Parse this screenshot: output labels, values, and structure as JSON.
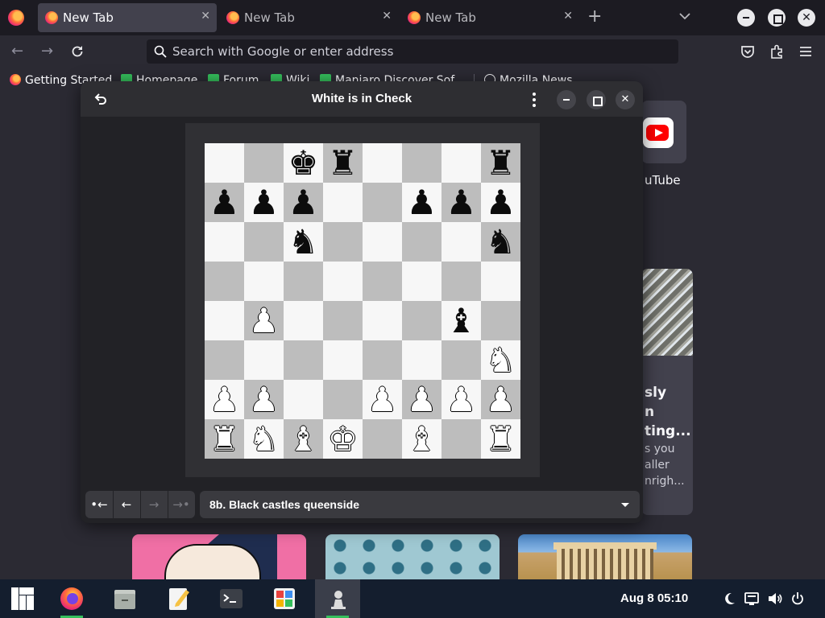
{
  "browser": {
    "tabs": [
      {
        "title": "New Tab",
        "active": true
      },
      {
        "title": "New Tab",
        "active": false
      },
      {
        "title": "New Tab",
        "active": false
      }
    ],
    "tab_close_glyph": "✕",
    "new_tab_glyph": "+",
    "urlbar": {
      "placeholder": "Search with Google or enter address",
      "value": ""
    },
    "bookmarks": [
      {
        "label": "Getting Started",
        "icon": "firefox-icon"
      },
      {
        "label": "Homepage",
        "icon": "manjaro-icon"
      },
      {
        "label": "Forum",
        "icon": "manjaro-icon"
      },
      {
        "label": "Wiki",
        "icon": "manjaro-icon"
      },
      {
        "label": "Manjaro Discover Sof...",
        "icon": "manjaro-icon"
      },
      {
        "label": "Mozilla News",
        "icon": "globe-icon"
      }
    ],
    "shortcut": {
      "label": "uTube",
      "icon": "youtube-icon"
    },
    "story": {
      "title": "sly\nn\nting...",
      "body": "s you\naller\nnrigh..."
    }
  },
  "chess": {
    "title": "White is in Check",
    "selected_move": "8b. Black castles queenside",
    "board": [
      [
        "",
        "",
        "bk",
        "br",
        "",
        "",
        "",
        "br"
      ],
      [
        "bp",
        "bp",
        "bp",
        "",
        "",
        "bp",
        "bp",
        "bp"
      ],
      [
        "",
        "",
        "bn",
        "",
        "",
        "",
        "",
        "bn"
      ],
      [
        "",
        "",
        "",
        "",
        "",
        "",
        "",
        ""
      ],
      [
        "",
        "wp",
        "",
        "",
        "",
        "",
        "bb",
        ""
      ],
      [
        "",
        "",
        "",
        "",
        "",
        "",
        "",
        "wn"
      ],
      [
        "wp",
        "wp",
        "",
        "",
        "wp",
        "wp",
        "wp",
        "wp"
      ],
      [
        "wr",
        "wn",
        "wb",
        "wk",
        "",
        "wb",
        "",
        "wr"
      ]
    ],
    "nav_buttons": [
      {
        "name": "first-move-button",
        "glyph": "•←",
        "enabled": true
      },
      {
        "name": "previous-move-button",
        "glyph": "←",
        "enabled": true
      },
      {
        "name": "next-move-button",
        "glyph": "→",
        "enabled": false
      },
      {
        "name": "last-move-button",
        "glyph": "→•",
        "enabled": false
      }
    ],
    "close_glyph": "✕"
  },
  "taskbar": {
    "items": [
      {
        "name": "manjaro-menu-icon"
      },
      {
        "name": "firefox-icon",
        "running": true
      },
      {
        "name": "file-manager-icon"
      },
      {
        "name": "text-editor-icon"
      },
      {
        "name": "terminal-icon"
      },
      {
        "name": "software-center-icon"
      },
      {
        "name": "chess-icon",
        "running": true,
        "active": true
      }
    ],
    "datetime": "Aug 8  05:10",
    "tray": [
      "night-light-icon",
      "network-icon",
      "volume-icon",
      "power-icon"
    ]
  },
  "colors": {
    "light_square": "#f7f7f7",
    "dark_square": "#bdbdbd",
    "taskbar_bg": "#141e2e",
    "running_indicator": "#35bf5c"
  }
}
